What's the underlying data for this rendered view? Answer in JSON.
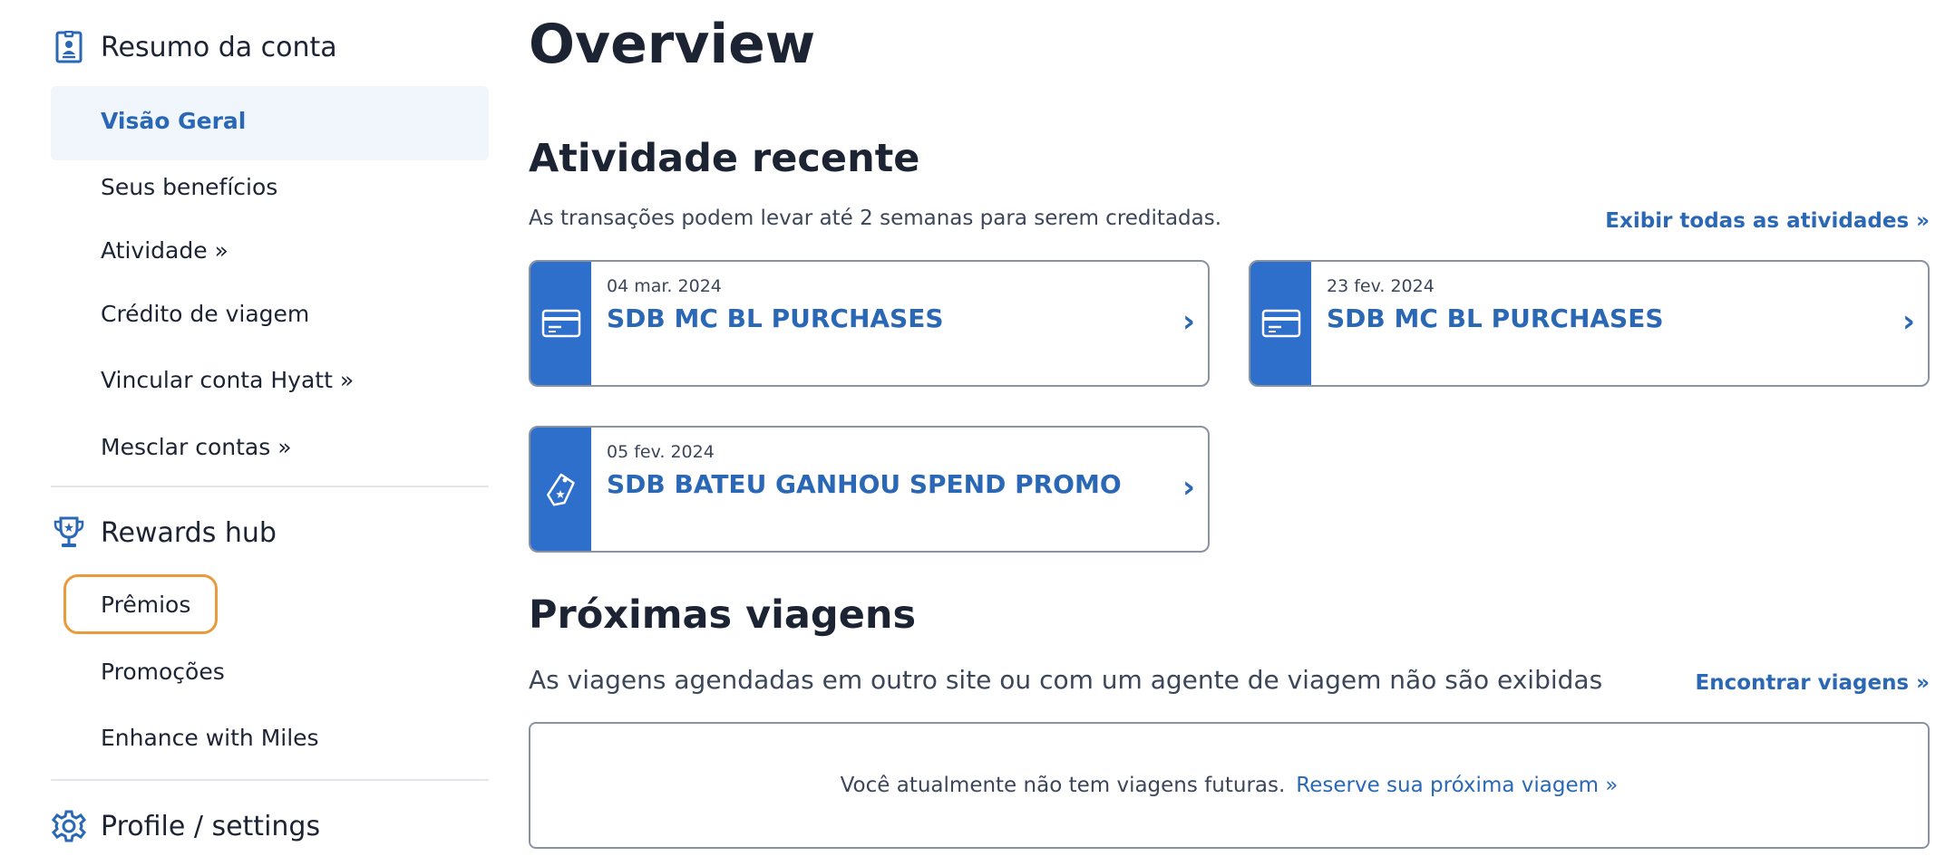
{
  "sidebar": {
    "account_section": {
      "title": "Resumo da conta",
      "icon": "account-summary-icon"
    },
    "account_items": [
      {
        "label": "Visão Geral",
        "active": true
      },
      {
        "label": "Seus benefícios"
      },
      {
        "label": "Atividade »"
      },
      {
        "label": "Crédito de viagem"
      },
      {
        "label": "Vincular conta Hyatt »"
      },
      {
        "label": "Mesclar contas »"
      }
    ],
    "rewards_section": {
      "title": "Rewards hub",
      "icon": "trophy-icon"
    },
    "rewards_items": [
      {
        "label": "Prêmios",
        "focused": true
      },
      {
        "label": "Promoções"
      },
      {
        "label": "Enhance with Miles"
      }
    ],
    "profile_section": {
      "title": "Profile / settings",
      "icon": "gear-icon"
    }
  },
  "main": {
    "title": "Overview",
    "recent": {
      "heading": "Atividade recente",
      "note": "As transações podem levar até 2 semanas para serem creditadas.",
      "view_all": "Exibir todas as atividades »",
      "transactions": [
        {
          "date": "04 mar. 2024",
          "merchant": "SDB MC BL PURCHASES",
          "icon": "credit-card-icon"
        },
        {
          "date": "23 fev. 2024",
          "merchant": "SDB MC BL PURCHASES",
          "icon": "credit-card-icon"
        },
        {
          "date": "05 fev. 2024",
          "merchant": "SDB BATEU GANHOU SPEND PROMO",
          "icon": "tag-icon"
        }
      ]
    },
    "trips": {
      "heading": "Próximas viagens",
      "note": "As viagens agendadas em outro site ou com um agente de viagem não são exibidas",
      "find_link": "Encontrar viagens »",
      "empty_message": "Você atualmente não tem viagens futuras.",
      "book_link": "Reserve sua próxima viagem »"
    }
  },
  "colors": {
    "accent": "#2a68b6",
    "stripe": "#2e6fcc",
    "active_bg": "#f1f6fc",
    "focus": "#e89a3c",
    "text": "#1c2434"
  }
}
